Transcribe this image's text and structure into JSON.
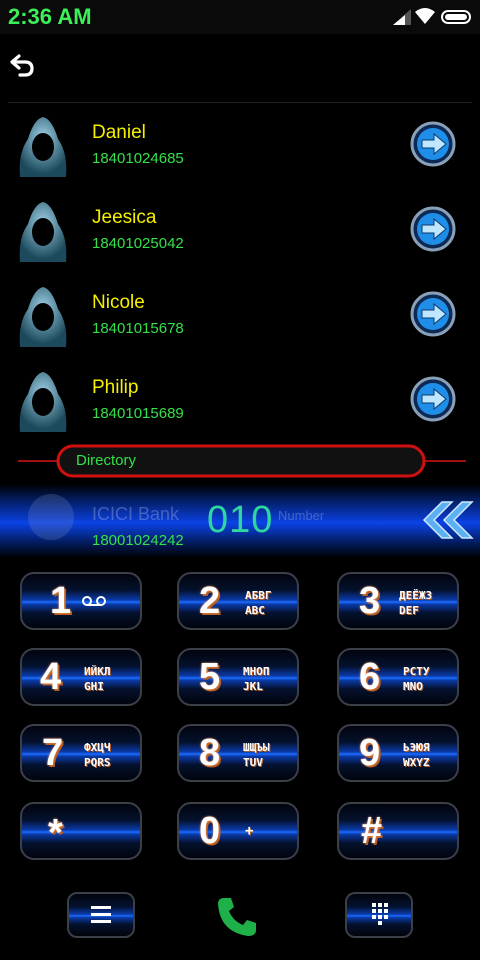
{
  "status": {
    "time": "2:36 AM",
    "icons": [
      "signal-icon",
      "wifi-icon",
      "battery-icon"
    ]
  },
  "toolbar": {
    "back_icon": "back-arrow-icon"
  },
  "contacts": [
    {
      "name": "Daniel",
      "number": "18401024685"
    },
    {
      "name": "Jeesica",
      "number": "18401025042"
    },
    {
      "name": "Nicole",
      "number": "18401015678"
    },
    {
      "name": "Philip",
      "number": "18401015689"
    }
  ],
  "directory": {
    "label": "Directory"
  },
  "dial": {
    "suggestion_name": "ICICI Bank",
    "suggestion_number": "18001024242",
    "entered": "010",
    "hint": "Number"
  },
  "keypad": [
    {
      "digit": "1",
      "line1": "",
      "line2": ""
    },
    {
      "digit": "2",
      "line1": "АБВГ",
      "line2": "ABC"
    },
    {
      "digit": "3",
      "line1": "ДЕЁЖЗ",
      "line2": "DEF"
    },
    {
      "digit": "4",
      "line1": "ИЙКЛ",
      "line2": "GHI"
    },
    {
      "digit": "5",
      "line1": "МНОП",
      "line2": "JKL"
    },
    {
      "digit": "6",
      "line1": "РСТУ",
      "line2": "MNO"
    },
    {
      "digit": "7",
      "line1": "ФХЦЧ",
      "line2": "PQRS"
    },
    {
      "digit": "8",
      "line1": "ШЩЪЫ",
      "line2": "TUV"
    },
    {
      "digit": "9",
      "line1": "ЬЭЮЯ",
      "line2": "WXYZ"
    },
    {
      "digit": "*",
      "line1": "",
      "line2": ""
    },
    {
      "digit": "0",
      "line1": "+",
      "line2": ""
    },
    {
      "digit": "#",
      "line1": "",
      "line2": ""
    }
  ],
  "bottom": {
    "menu_icon": "menu-icon",
    "call_icon": "phone-icon",
    "dialpad_icon": "dialpad-icon"
  },
  "colors": {
    "name": "#f4f000",
    "number": "#34e04a",
    "accent_blue": "#1b6cff",
    "directory_border": "#d01010"
  }
}
